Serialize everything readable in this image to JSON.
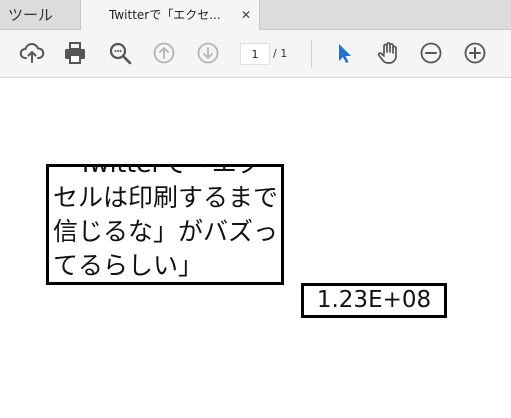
{
  "tabs": {
    "tools_label": "ツール",
    "document_title": "Twitterで「エクセ...",
    "close_glyph": "✕"
  },
  "toolbar": {
    "icons": [
      "cloud-upload-icon",
      "print-icon",
      "zoom-search-icon",
      "page-up-icon",
      "page-down-icon",
      "select-arrow-icon",
      "hand-tool-icon",
      "zoom-out-icon",
      "zoom-in-icon"
    ],
    "page_current": "1",
    "page_total": "/ 1"
  },
  "document": {
    "cell_text": "「Twitterで「エクセルは印刷するまで信じるな」がバズってるらしい」",
    "number_text": "1.23E+08"
  },
  "colors": {
    "active_tool": "#1e73d2",
    "icon_default": "#555555",
    "icon_disabled": "#b5b5b5"
  }
}
